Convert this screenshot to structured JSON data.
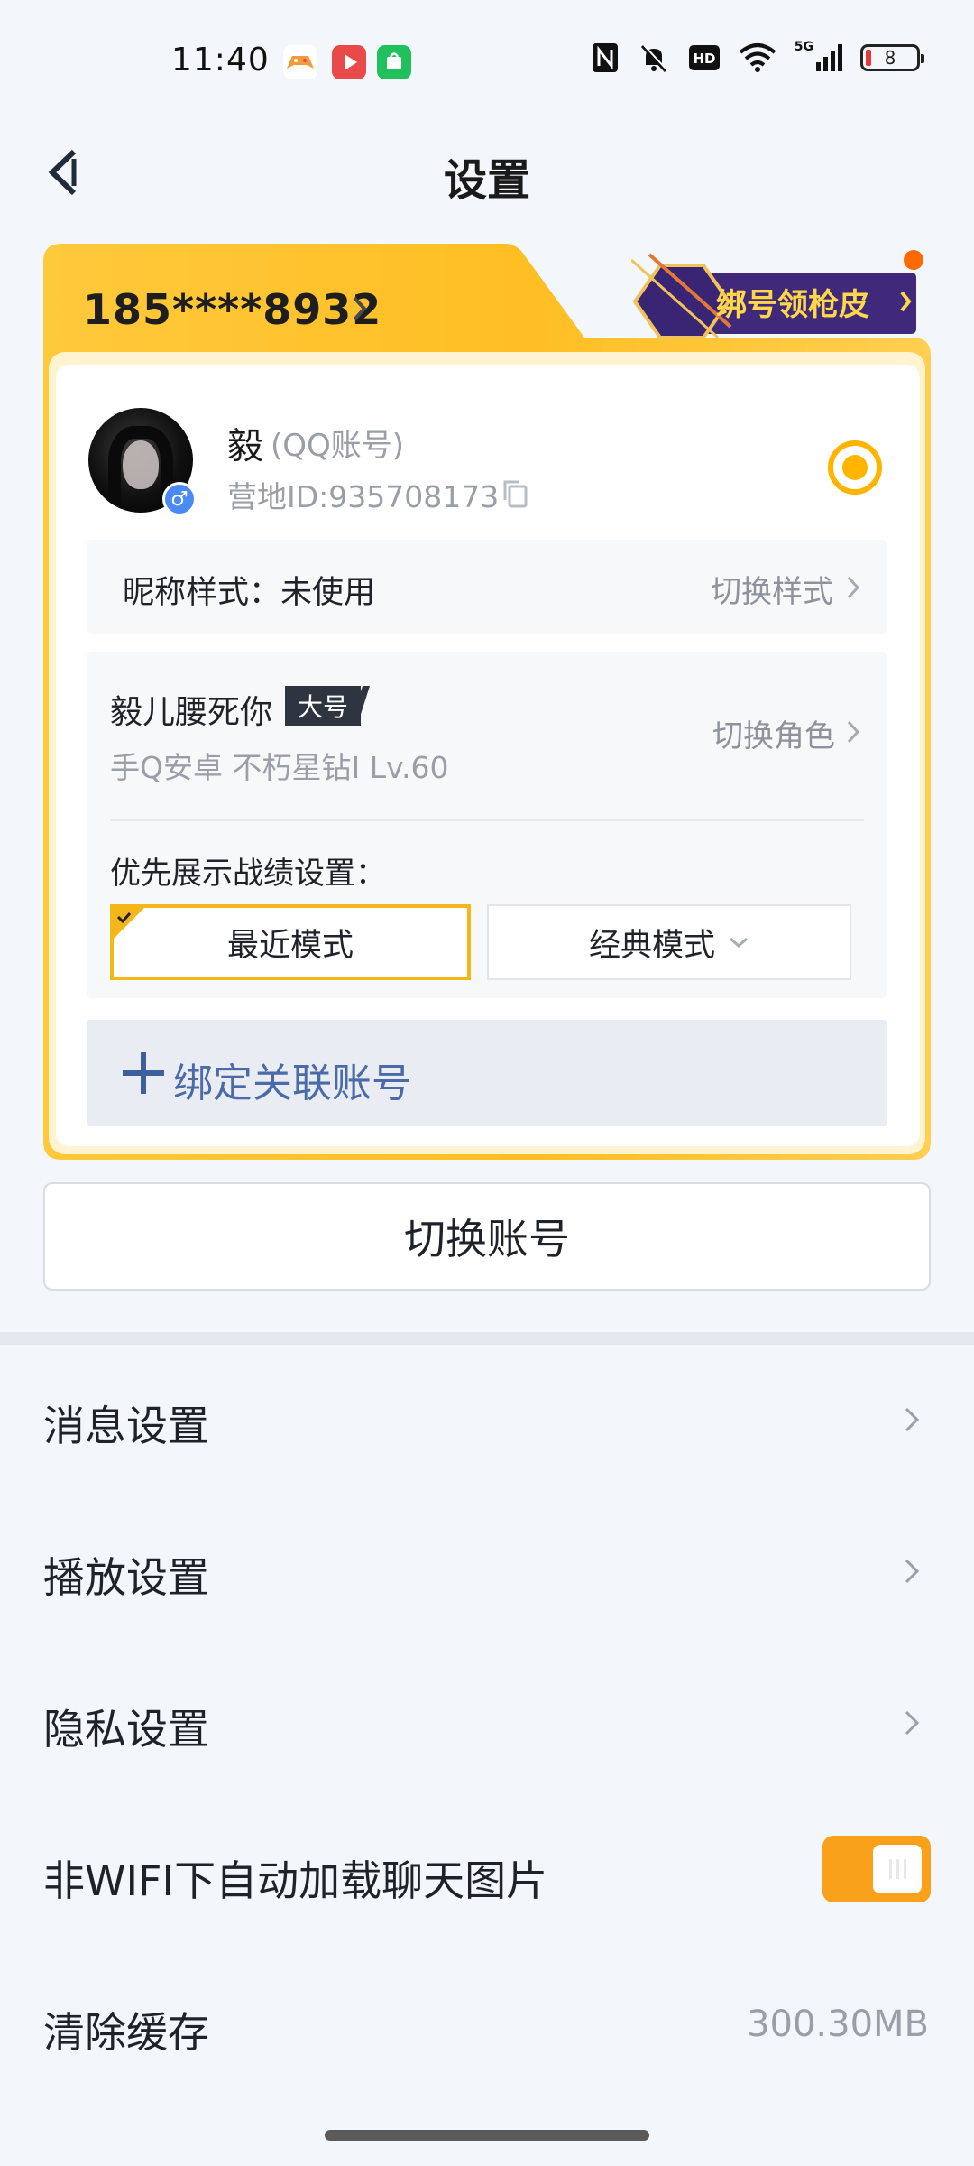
{
  "status_bar": {
    "time": "11:40",
    "network": "5G",
    "battery_level": "8",
    "hd_label": "HD",
    "colors": {
      "app1": "#f39b3a",
      "app2": "#e84a4a",
      "app3": "#20c05c"
    }
  },
  "header": {
    "title": "设置",
    "back_icon": "back-arrow-icon"
  },
  "account_card": {
    "phone": "185****8932",
    "promo_label": "绑号领枪皮",
    "nickname": "毅",
    "account_type": "(QQ账号)",
    "camp_id": "营地ID:935708173",
    "gender": "♂",
    "nick_style": {
      "label": "昵称样式：未使用",
      "action": "切换样式"
    },
    "role": {
      "name": "毅儿腰死你",
      "tag": "大号",
      "detail": "手Q安卓  不朽星钻I  Lv.60",
      "action": "切换角色"
    },
    "priority": {
      "label": "优先展示战绩设置：",
      "options": [
        "最近模式",
        "经典模式"
      ],
      "selected": "最近模式"
    },
    "bind_label": "绑定关联账号",
    "accent_color": "#f5b61a"
  },
  "switch_account_label": "切换账号",
  "settings": {
    "message": "消息设置",
    "playback": "播放设置",
    "privacy": "隐私设置",
    "auto_load": "非WIFI下自动加载聊天图片",
    "auto_load_on": true,
    "clear_cache": "清除缓存",
    "cache_size": "300.30MB"
  }
}
